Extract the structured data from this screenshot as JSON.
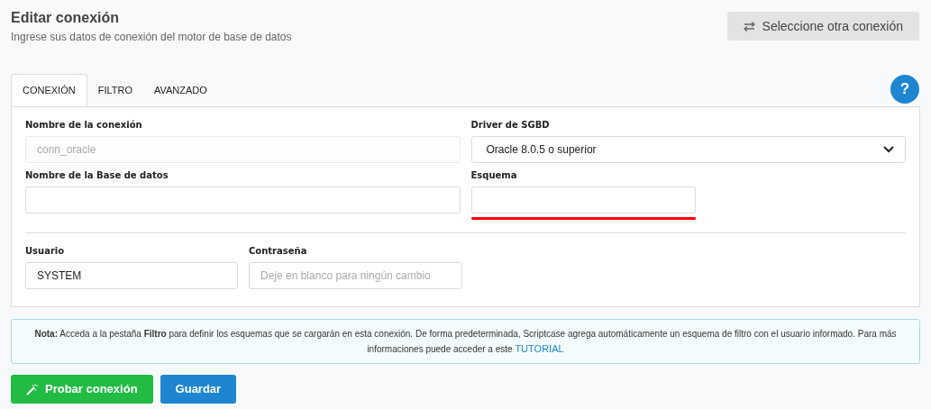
{
  "header": {
    "title": "Editar conexión",
    "subtitle": "Ingrese sus datos de conexión del motor de base de datos",
    "switch_button": "Seleccione otra conexión"
  },
  "tabs": [
    {
      "label": "CONEXIÓN",
      "selected": true
    },
    {
      "label": "FILTRO",
      "selected": false
    },
    {
      "label": "AVANZADO",
      "selected": false
    }
  ],
  "help_button": "?",
  "fields": [
    {
      "label": "Nombre de la conexión",
      "kind": "input",
      "value": "conn_oracle",
      "disabled": true
    },
    {
      "label": "Driver de SGBD",
      "kind": "select",
      "value": "Oracle 8.0.5 o superior",
      "disabled": false
    },
    {
      "label": "Nombre de la Base de datos",
      "kind": "input",
      "disabled": false
    },
    {
      "label": "Esquema",
      "kind": "input",
      "disabled": false,
      "highlighted": true
    }
  ],
  "credentials": [
    {
      "label": "Usuario",
      "kind": "input",
      "value": "SYSTEM",
      "disabled": false
    },
    {
      "label": "Contraseña",
      "kind": "input",
      "placeholder": "Deje en blanco para ningún cambio",
      "disabled": false
    }
  ],
  "note": {
    "text": "**Nota:** Acceda a la pestaña **Filtro** para definir los esquemas que se cargarán en esta conexión. De forma predeterminada, Scriptcase agrega automáticamente un esquema de filtro con el usuario informado. Para más informaciones puede acceder a este",
    "link": "TUTORIAL"
  },
  "buttons": [
    {
      "label": "Probar conexión",
      "kind": "test"
    },
    {
      "label": "Guardar",
      "kind": "save"
    }
  ]
}
